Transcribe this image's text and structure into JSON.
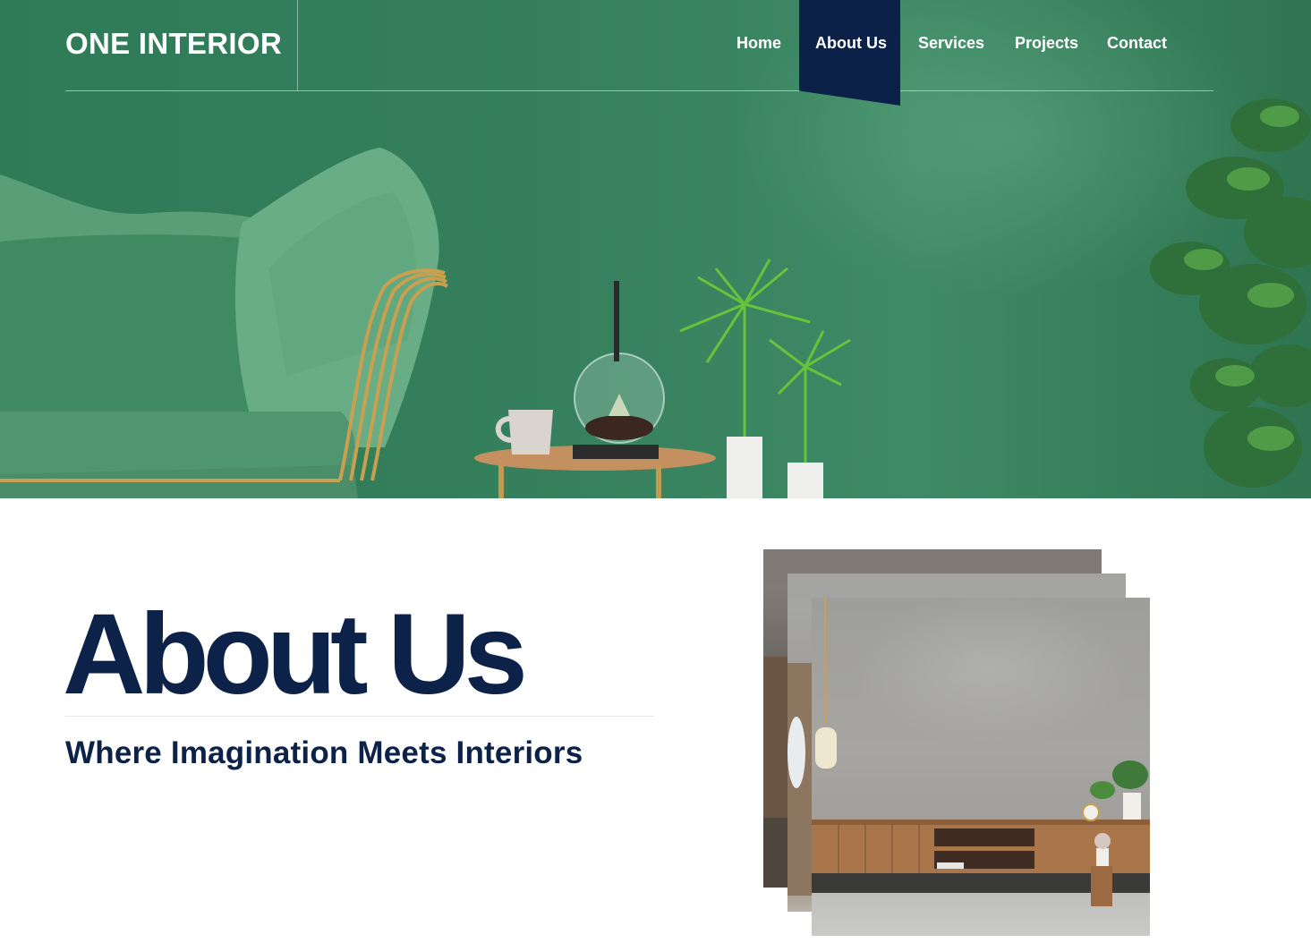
{
  "site": {
    "logo": "ONE INTERIOR"
  },
  "nav": {
    "items": [
      {
        "label": "Home",
        "active": false
      },
      {
        "label": "About Us",
        "active": true
      },
      {
        "label": "Services",
        "active": false
      },
      {
        "label": "Projects",
        "active": false
      },
      {
        "label": "Contact",
        "active": false
      }
    ],
    "active_color": "#0c2147"
  },
  "hero": {
    "image": "green-living-room-sofa-plants-icon"
  },
  "about": {
    "title": "About Us",
    "subtitle": "Where Imagination Meets Interiors"
  },
  "gallery": {
    "images": [
      "living-room-photo-icon",
      "living-room-photo-icon",
      "concrete-wall-tv-cabinet-photo-icon"
    ]
  },
  "colors": {
    "brand_navy": "#0d2249",
    "hero_green": "#357f5c"
  }
}
